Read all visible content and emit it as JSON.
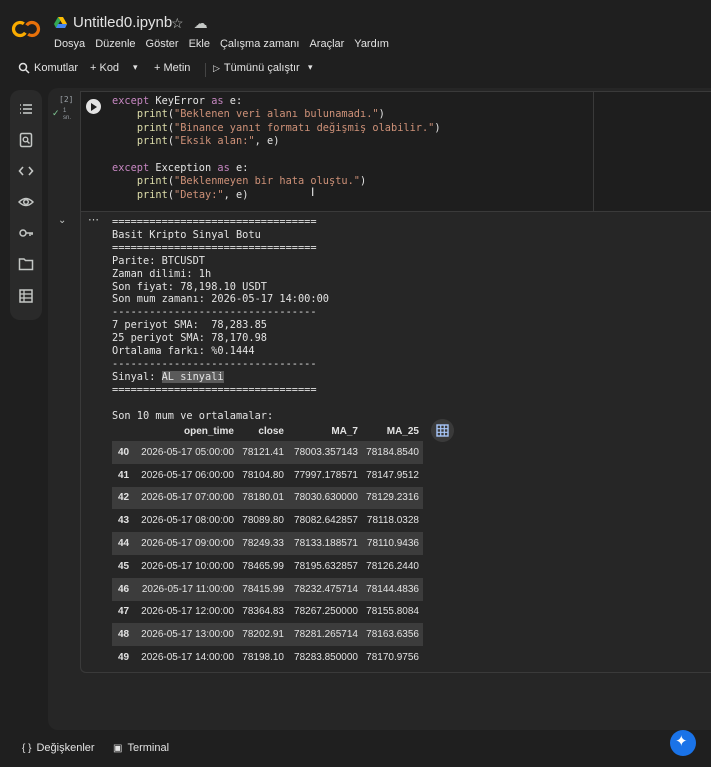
{
  "header": {
    "filename": "Untitled0.ipynb",
    "menu": [
      "Dosya",
      "Düzenle",
      "Göster",
      "Ekle",
      "Çalışma zamanı",
      "Araçlar",
      "Yardım"
    ]
  },
  "toolbar": {
    "commands": "Komutlar",
    "add_code": "+ Kod",
    "add_text": "+ Metin",
    "run_all": "Tümünü çalıştır"
  },
  "sidebar": {
    "icons": [
      "toc-icon",
      "find-icon",
      "code-snippets-icon",
      "variables-icon",
      "secrets-key-icon",
      "files-icon",
      "table-icon"
    ]
  },
  "cell": {
    "exec_count": "[2]",
    "exec_time": "1 sn.",
    "code_lines": [
      {
        "indent": "",
        "parts": [
          [
            "kw",
            "except"
          ],
          [
            "var",
            " KeyError "
          ],
          [
            "kw",
            "as"
          ],
          [
            "var",
            " e:"
          ]
        ]
      },
      {
        "indent": "    ",
        "parts": [
          [
            "fn",
            "print"
          ],
          [
            "var",
            "("
          ],
          [
            "str",
            "\"Beklenen veri alanı bulunamadı.\""
          ],
          [
            "var",
            ")"
          ]
        ]
      },
      {
        "indent": "    ",
        "parts": [
          [
            "fn",
            "print"
          ],
          [
            "var",
            "("
          ],
          [
            "str",
            "\"Binance yanıt formatı değişmiş olabilir.\""
          ],
          [
            "var",
            ")"
          ]
        ]
      },
      {
        "indent": "    ",
        "parts": [
          [
            "fn",
            "print"
          ],
          [
            "var",
            "("
          ],
          [
            "str",
            "\"Eksik alan:\""
          ],
          [
            "var",
            ", e)"
          ]
        ]
      },
      {
        "indent": "",
        "parts": [
          [
            "var",
            ""
          ]
        ]
      },
      {
        "indent": "",
        "parts": [
          [
            "kw",
            "except"
          ],
          [
            "var",
            " Exception "
          ],
          [
            "kw",
            "as"
          ],
          [
            "var",
            " e:"
          ]
        ]
      },
      {
        "indent": "    ",
        "parts": [
          [
            "fn",
            "print"
          ],
          [
            "var",
            "("
          ],
          [
            "str",
            "\"Beklenmeyen bir hata oluştu.\""
          ],
          [
            "var",
            ")"
          ]
        ]
      },
      {
        "indent": "    ",
        "parts": [
          [
            "fn",
            "print"
          ],
          [
            "var",
            "("
          ],
          [
            "str",
            "\"Detay:\""
          ],
          [
            "var",
            ", e)"
          ]
        ]
      }
    ]
  },
  "output": {
    "lines_before_signal": [
      "=================================",
      "Basit Kripto Sinyal Botu",
      "=================================",
      "Parite: BTCUSDT",
      "Zaman dilimi: 1h",
      "Son fiyat: 78,198.10 USDT",
      "Son mum zamanı: 2026-05-17 14:00:00",
      "---------------------------------",
      "7 periyot SMA:  78,283.85",
      "25 periyot SMA: 78,170.98",
      "Ortalama farkı: %0.1444",
      "---------------------------------"
    ],
    "signal_label": "Sinyal: ",
    "signal_value": "AL sinyali",
    "lines_after_signal": [
      "=================================",
      "",
      "Son 10 mum ve ortalamalar:"
    ]
  },
  "dataframe": {
    "columns": [
      "",
      "open_time",
      "close",
      "MA_7",
      "MA_25"
    ],
    "rows": [
      [
        "40",
        "2026-05-17 05:00:00",
        "78121.41",
        "78003.357143",
        "78184.8540"
      ],
      [
        "41",
        "2026-05-17 06:00:00",
        "78104.80",
        "77997.178571",
        "78147.9512"
      ],
      [
        "42",
        "2026-05-17 07:00:00",
        "78180.01",
        "78030.630000",
        "78129.2316"
      ],
      [
        "43",
        "2026-05-17 08:00:00",
        "78089.80",
        "78082.642857",
        "78118.0328"
      ],
      [
        "44",
        "2026-05-17 09:00:00",
        "78249.33",
        "78133.188571",
        "78110.9436"
      ],
      [
        "45",
        "2026-05-17 10:00:00",
        "78465.99",
        "78195.632857",
        "78126.2440"
      ],
      [
        "46",
        "2026-05-17 11:00:00",
        "78415.99",
        "78232.475714",
        "78144.4836"
      ],
      [
        "47",
        "2026-05-17 12:00:00",
        "78364.83",
        "78267.250000",
        "78155.8084"
      ],
      [
        "48",
        "2026-05-17 13:00:00",
        "78202.91",
        "78281.265714",
        "78163.6356"
      ],
      [
        "49",
        "2026-05-17 14:00:00",
        "78198.10",
        "78283.850000",
        "78170.9756"
      ]
    ]
  },
  "bottombar": {
    "variables": "Değişkenler",
    "terminal": "Terminal"
  }
}
